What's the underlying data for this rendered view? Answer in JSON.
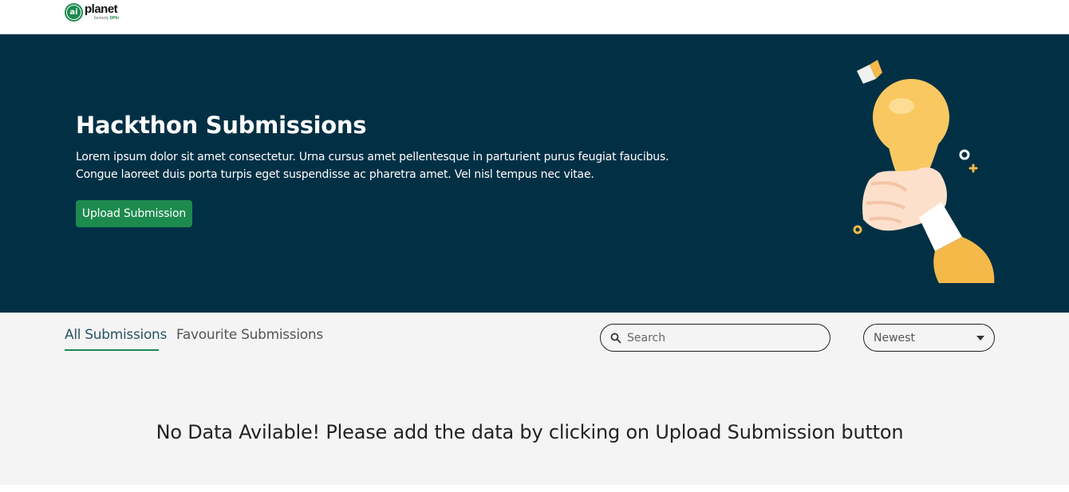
{
  "header": {
    "logo_mark": "ai",
    "logo_name": "planet",
    "logo_sub_prefix": "formerly ",
    "logo_sub_brand": "DPhi"
  },
  "hero": {
    "title": "Hackthon Submissions",
    "description": "Lorem ipsum dolor sit amet consectetur. Urna cursus amet pellentesque in parturient purus feugiat faucibus. Congue laoreet duis porta turpis eget suspendisse ac pharetra amet. Vel nisl tempus nec vitae.",
    "upload_button": "Upload Submission",
    "illustration_icon": "hand-holding-lightbulb-icon"
  },
  "tabs": [
    {
      "label": "All Submissions",
      "active": true
    },
    {
      "label": "Favourite Submissions",
      "active": false
    }
  ],
  "search": {
    "placeholder": "Search",
    "value": ""
  },
  "sort": {
    "selected": "Newest"
  },
  "empty_state": "No Data Avilable! Please add the data by clicking on Upload Submission button",
  "colors": {
    "brand_green": "#1d8a4e",
    "hero_bg": "#013045",
    "content_bg": "#f4f4f4"
  }
}
